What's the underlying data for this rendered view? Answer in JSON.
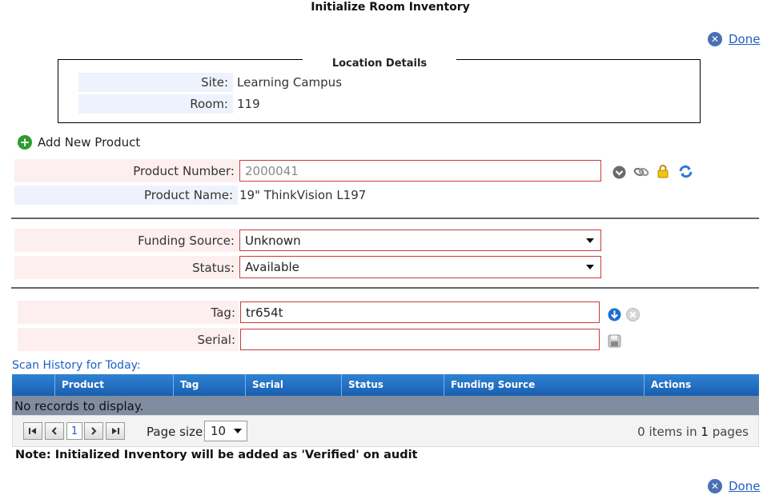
{
  "page": {
    "title": "Initialize Room Inventory",
    "done_label": "Done"
  },
  "location": {
    "legend": "Location Details",
    "site_label": "Site:",
    "site_value": "Learning Campus",
    "room_label": "Room:",
    "room_value": "119"
  },
  "product": {
    "add_label": "Add New Product",
    "number_label": "Product Number:",
    "number_value": "2000041",
    "name_label": "Product Name:",
    "name_value": "19\" ThinkVision L197"
  },
  "details": {
    "funding_label": "Funding Source:",
    "funding_value": "Unknown",
    "status_label": "Status:",
    "status_value": "Available"
  },
  "tagging": {
    "tag_label": "Tag:",
    "tag_value": "tr654t",
    "serial_label": "Serial:",
    "serial_value": ""
  },
  "history": {
    "title": "Scan History for Today:",
    "columns": [
      "Product",
      "Tag",
      "Serial",
      "Status",
      "Funding Source",
      "Actions"
    ],
    "no_records": "No records to display."
  },
  "pager": {
    "current_page": "1",
    "page_size_label": "Page size:",
    "page_size_value": "10",
    "items_count": "0",
    "items_in_label": "items in",
    "pages_count": "1",
    "pages_label": "pages"
  },
  "note": "Note: Initialized Inventory will be added as 'Verified' on audit",
  "colors": {
    "accent": "#1f5fc7",
    "required_border": "#c93b3b",
    "grid_header": "#2f82d4"
  }
}
